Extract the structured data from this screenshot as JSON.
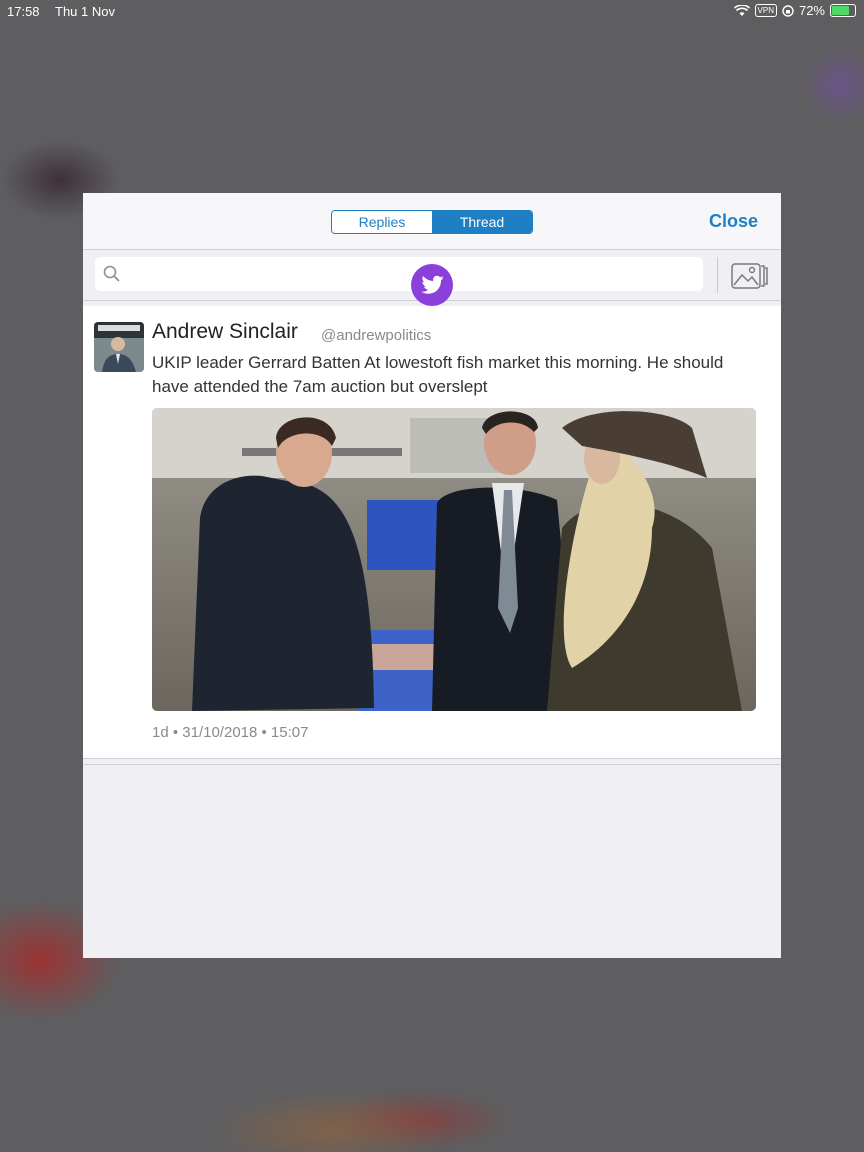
{
  "status_bar": {
    "time": "17:58",
    "date": "Thu 1 Nov",
    "vpn": "VPN",
    "battery": "72%"
  },
  "header": {
    "tabs": [
      {
        "label": "Replies",
        "selected": false
      },
      {
        "label": "Thread",
        "selected": true
      }
    ],
    "close_label": "Close"
  },
  "search": {
    "placeholder": "",
    "icon": "search-icon"
  },
  "tweet": {
    "name": "Andrew Sinclair",
    "handle": "@andrewpolitics",
    "text": "UKIP leader Gerrard Batten At lowestoft fish market this morning. He should have attended the 7am auction but overslept",
    "meta": "1d • 31/10/2018 • 15:07"
  },
  "colors": {
    "accent": "#1f7fc4",
    "fab": "#8b3fdb"
  }
}
